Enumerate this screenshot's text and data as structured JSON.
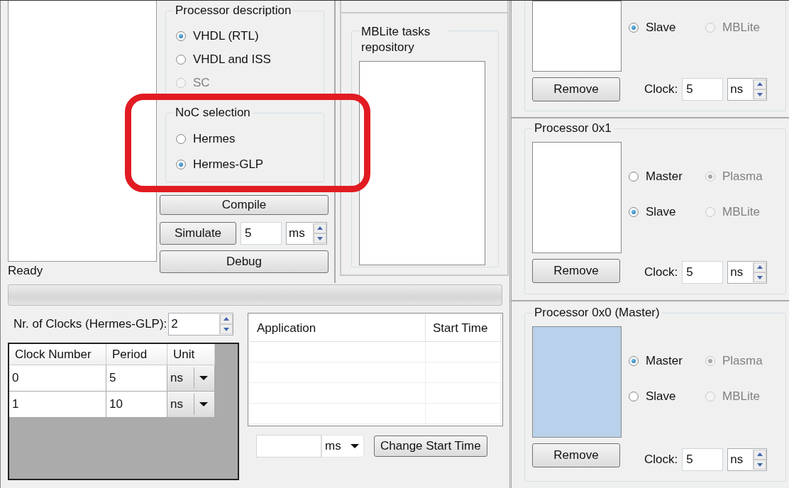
{
  "log": {
    "status": "Ready"
  },
  "processor_description": {
    "title": "Processor description",
    "options": [
      {
        "label": "VHDL (RTL)",
        "selected": true,
        "disabled": false
      },
      {
        "label": "VHDL and ISS",
        "selected": false,
        "disabled": false
      },
      {
        "label": "SC",
        "selected": false,
        "disabled": true
      }
    ]
  },
  "noc_selection": {
    "title": "NoC selection",
    "options": [
      {
        "label": "Hermes",
        "selected": false,
        "disabled": false
      },
      {
        "label": "Hermes-GLP",
        "selected": true,
        "disabled": false
      }
    ]
  },
  "compile_button": "Compile",
  "simulate": {
    "button": "Simulate",
    "value": "5",
    "unit": "ms"
  },
  "debug_button": "Debug",
  "mblite_repository": {
    "title": "MBLite tasks repository"
  },
  "progress": {
    "level": 0
  },
  "clocks": {
    "label": "Nr. of Clocks (Hermes-GLP):",
    "value": "2",
    "columns": [
      "Clock Number",
      "Period",
      "Unit"
    ],
    "rows": [
      {
        "number": "0",
        "period": "5",
        "unit": "ns"
      },
      {
        "number": "1",
        "period": "10",
        "unit": "ns"
      }
    ]
  },
  "applications": {
    "columns": [
      "Application",
      "Start Time"
    ]
  },
  "start_time": {
    "unit": "ms",
    "button": "Change Start Time"
  },
  "processors": [
    {
      "highlighted": false,
      "rows": [
        {
          "role": {
            "label": "Slave",
            "selected": true
          },
          "core": {
            "label": "MBLite",
            "selected": false,
            "disabled": true
          }
        }
      ],
      "remove": "Remove",
      "clock_label": "Clock:",
      "clock": "5",
      "clock_unit": "ns"
    },
    {
      "title": "Processor 0x1",
      "highlighted": false,
      "rows": [
        {
          "role": {
            "label": "Master",
            "selected": false
          },
          "core": {
            "label": "Plasma",
            "selected": true,
            "disabled": true
          }
        },
        {
          "role": {
            "label": "Slave",
            "selected": true
          },
          "core": {
            "label": "MBLite",
            "selected": false,
            "disabled": true
          }
        }
      ],
      "remove": "Remove",
      "clock_label": "Clock:",
      "clock": "5",
      "clock_unit": "ns"
    },
    {
      "title": "Processor 0x0 (Master)",
      "highlighted": true,
      "rows": [
        {
          "role": {
            "label": "Master",
            "selected": true
          },
          "core": {
            "label": "Plasma",
            "selected": true,
            "disabled": true
          }
        },
        {
          "role": {
            "label": "Slave",
            "selected": false
          },
          "core": {
            "label": "MBLite",
            "selected": false,
            "disabled": true
          }
        }
      ],
      "remove": "Remove",
      "clock_label": "Clock:",
      "clock": "5",
      "clock_unit": "ns"
    }
  ]
}
